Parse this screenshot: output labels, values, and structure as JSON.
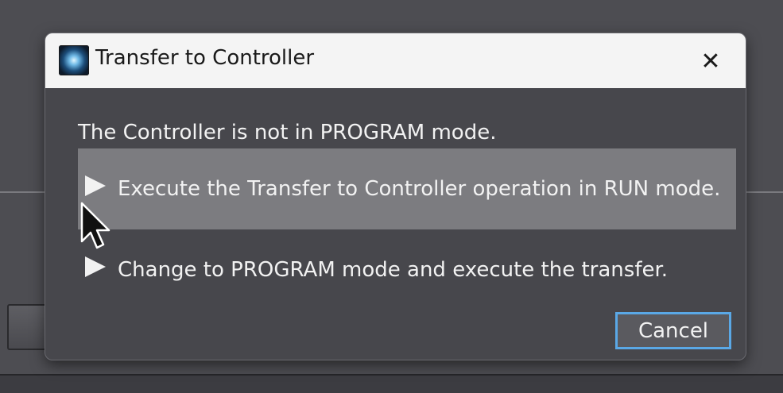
{
  "dialog": {
    "title": "Transfer to Controller",
    "close_symbol": "✕",
    "message": "The Controller is not in PROGRAM mode.",
    "options": [
      {
        "label": "Execute the Transfer to Controller operation in RUN mode.",
        "icon": "play-arrow-icon",
        "hovered": true
      },
      {
        "label": "Change to PROGRAM mode and execute the transfer.",
        "icon": "play-arrow-icon",
        "hovered": false
      }
    ],
    "cancel_label": "Cancel"
  },
  "colors": {
    "dialog_background": "#47474c",
    "titlebar_background": "#f4f4f4",
    "option_hover": "#7c7c80",
    "focus_border": "#5aa8e6"
  },
  "icons": {
    "app_icon": "app-logo-icon",
    "close": "close-icon",
    "cursor": "mouse-pointer-icon"
  }
}
